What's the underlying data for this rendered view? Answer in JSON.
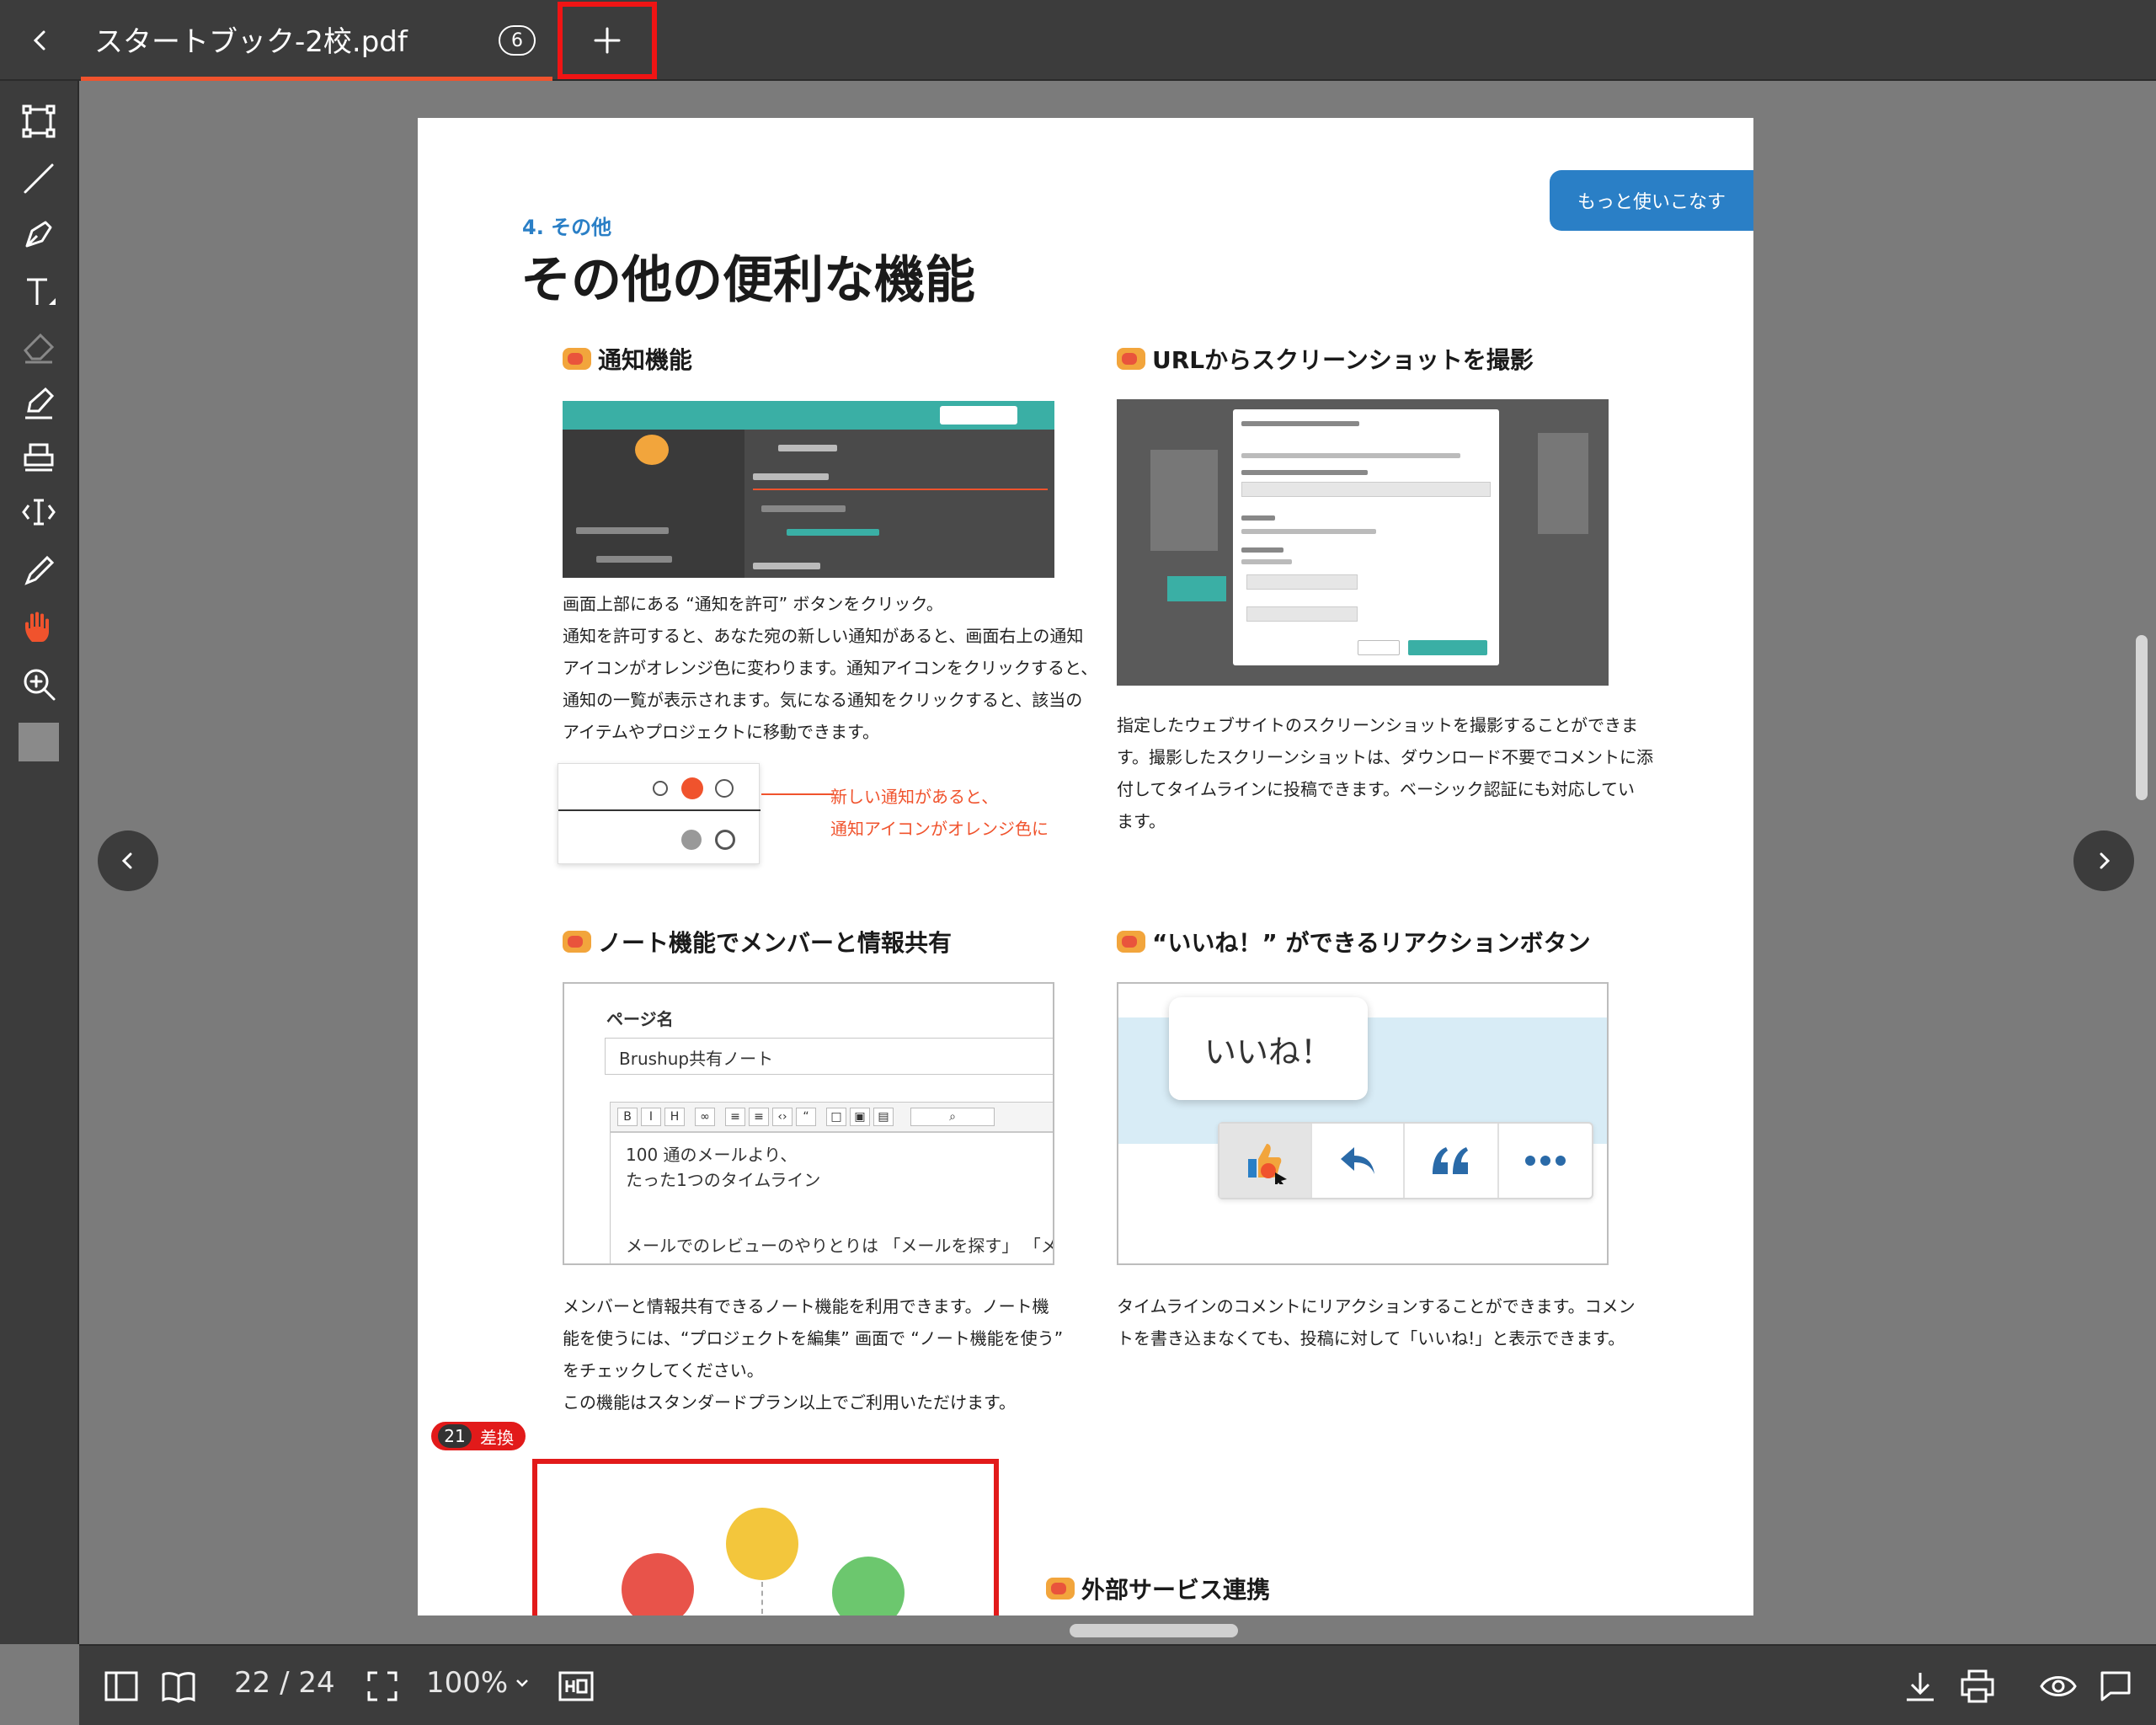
{
  "tab": {
    "title": "スタートブック-2校.pdf",
    "count": "6"
  },
  "toolbar": {
    "items": [
      "rectangle-select",
      "line",
      "pen",
      "text",
      "eraser",
      "highlighter",
      "stamp",
      "text-cursor",
      "brush",
      "hand",
      "zoom-in",
      "color-swatch"
    ],
    "active": "hand",
    "active_color": "#f0532d"
  },
  "bottom": {
    "page_indicator": "22 / 24",
    "zoom": "100%"
  },
  "page": {
    "badge": "もっと使いこなす",
    "section_number": "4. その他",
    "heading": "その他の便利な機能",
    "notification": {
      "title": "通知機能",
      "body": [
        "画面上部にある “通知を許可” ボタンをクリック。",
        "通知を許可すると、あなた宛の新しい通知があると、画面右上の通知",
        "アイコンがオレンジ色に変わります。通知アイコンをクリックすると、",
        "通知の一覧が表示されます。気になる通知をクリックすると、該当の",
        "アイテムやプロジェクトに移動できます。"
      ],
      "note_line1": "新しい通知があると、",
      "note_line2": "通知アイコンがオレンジ色に"
    },
    "screenshot": {
      "title": "URLからスクリーンショットを撮影",
      "body": [
        "指定したウェブサイトのスクリーンショットを撮影することができま",
        "す。撮影したスクリーンショットは、ダウンロード不要でコメントに添",
        "付してタイムラインに投稿できます。ベーシック認証にも対応してい",
        "ます。"
      ]
    },
    "note": {
      "title": "ノート機能でメンバーと情報共有",
      "page_label": "ページ名",
      "page_value": "Brushup共有ノート",
      "line1": "100 通のメールより、",
      "line2": "たった1つのタイムライン",
      "line3": "メールでのレビューのやりとりは 「メールを探す」 「メ",
      "body": [
        "メンバーと情報共有できるノート機能を利用できます。ノート機",
        "能を使うには、“プロジェクトを編集” 画面で “ノート機能を使う”",
        "をチェックしてください。",
        "この機能はスタンダードプラン以上でご利用いただけます。"
      ]
    },
    "reaction": {
      "title": "“いいね！” ができるリアクションボタン",
      "bubble": "いいね！",
      "body": [
        "タイムラインのコメントにリアクションすることができます。コメン",
        "トを書き込まなくても、投稿に対して「いいね!」と表示できます。"
      ]
    },
    "revision": {
      "number": "21",
      "label": "差換"
    },
    "external": {
      "title": "外部サービス連携"
    }
  }
}
